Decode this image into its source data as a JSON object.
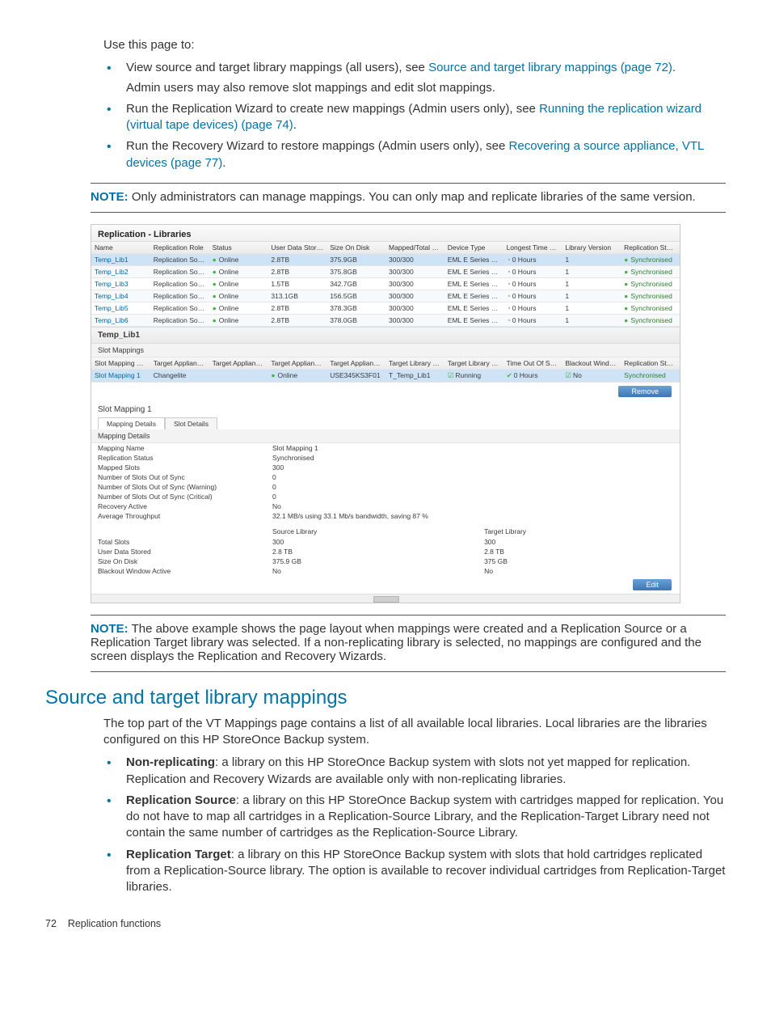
{
  "intro": "Use this page to:",
  "bullets_top": [
    {
      "pre": "View source and target library mappings (all users), see ",
      "link": "Source and target library mappings (page 72)",
      "post": ".",
      "sub": "Admin users may also remove slot mappings and edit slot mappings."
    },
    {
      "pre": "Run the Replication Wizard to create new mappings (Admin users only), see ",
      "link": "Running the replication wizard (virtual tape devices) (page 74)",
      "post": "."
    },
    {
      "pre": "Run the Recovery Wizard to restore mappings (Admin users only), see ",
      "link": "Recovering a source appliance, VTL devices (page 77)",
      "post": "."
    }
  ],
  "note1": {
    "label": "NOTE:",
    "text": "Only administrators can manage mappings. You can only map and replicate libraries of the same version."
  },
  "screenshot": {
    "title": "Replication - Libraries",
    "cols": [
      "Name",
      "Replication Role",
      "Status",
      "User Data Stored",
      "Size On Disk",
      "Mapped/Total S...",
      "Device Type",
      "Longest Time O...",
      "Library Version",
      "Replication Stat..."
    ],
    "rows": [
      {
        "name": "Temp_Lib1",
        "role": "Replication Sou...",
        "status": "Online",
        "uds": "2.8TB",
        "sod": "375.9GB",
        "mts": "300/300",
        "dt": "EML E Series / ...",
        "lto": "0 Hours",
        "lv": "1",
        "rs": "Synchronised",
        "sel": true
      },
      {
        "name": "Temp_Lib2",
        "role": "Replication Sou...",
        "status": "Online",
        "uds": "2.8TB",
        "sod": "375.8GB",
        "mts": "300/300",
        "dt": "EML E Series / ...",
        "lto": "0 Hours",
        "lv": "1",
        "rs": "Synchronised"
      },
      {
        "name": "Temp_Lib3",
        "role": "Replication Sou...",
        "status": "Online",
        "uds": "1.5TB",
        "sod": "342.7GB",
        "mts": "300/300",
        "dt": "EML E Series / ...",
        "lto": "0 Hours",
        "lv": "1",
        "rs": "Synchronised"
      },
      {
        "name": "Temp_Lib4",
        "role": "Replication Sou...",
        "status": "Online",
        "uds": "313.1GB",
        "sod": "156.5GB",
        "mts": "300/300",
        "dt": "EML E Series / ...",
        "lto": "0 Hours",
        "lv": "1",
        "rs": "Synchronised"
      },
      {
        "name": "Temp_Lib5",
        "role": "Replication Sou...",
        "status": "Online",
        "uds": "2.8TB",
        "sod": "378.3GB",
        "mts": "300/300",
        "dt": "EML E Series / ...",
        "lto": "0 Hours",
        "lv": "1",
        "rs": "Synchronised"
      },
      {
        "name": "Temp_Lib6",
        "role": "Replication Sou...",
        "status": "Online",
        "uds": "2.8TB",
        "sod": "378.0GB",
        "mts": "300/300",
        "dt": "EML E Series / ...",
        "lto": "0 Hours",
        "lv": "1",
        "rs": "Synchronised"
      }
    ],
    "detail_header": "Temp_Lib1",
    "detail_sub": "Slot Mappings",
    "map_cols": [
      "Slot Mapping Name",
      "Target Appliance Name",
      "Target Appliance Address",
      "Target Appliance Online",
      "Target Appliance Serial Number",
      "Target Library Name",
      "Target Library Status",
      "Time Out Of Sync",
      "Blackout Window Active",
      "Replication Status"
    ],
    "map_row": {
      "smn": "Slot Mapping 1",
      "tan": "Changelite",
      "taa": "",
      "tao": "Online",
      "tasn": "USE345KS3F01",
      "tln": "T_Temp_Lib1",
      "tls": "Running",
      "toos": "0 Hours",
      "bwa": "No",
      "rs": "Synchronised"
    },
    "remove_btn": "Remove",
    "sm_title": "Slot Mapping 1",
    "tabs": [
      "Mapping Details",
      "Slot Details"
    ],
    "tab_sub": "Mapping Details",
    "kv": [
      [
        "Mapping Name",
        "Slot Mapping 1"
      ],
      [
        "Replication Status",
        "Synchronised"
      ],
      [
        "Mapped Slots",
        "300"
      ],
      [
        "Number of Slots Out of Sync",
        "0"
      ],
      [
        "Number of Slots Out of Sync (Warning)",
        "0"
      ],
      [
        "Number of Slots Out of Sync (Critical)",
        "0"
      ],
      [
        "Recovery Active",
        "No"
      ],
      [
        "Average Throughput",
        "32.1 MB/s using 33.1 Mb/s bandwidth, saving 87 %"
      ]
    ],
    "split_heads": [
      "",
      "Source Library",
      "Target Library"
    ],
    "split_rows": [
      [
        "Total Slots",
        "300",
        "300"
      ],
      [
        "User Data Stored",
        "2.8 TB",
        "2.8 TB"
      ],
      [
        "Size On Disk",
        "375.9 GB",
        "375 GB"
      ],
      [
        "Blackout Window Active",
        "No",
        "No"
      ]
    ],
    "edit_btn": "Edit"
  },
  "note2": {
    "label": "NOTE:",
    "text": "The above example shows the page layout when mappings were created and a Replication Source or a Replication Target library was selected. If a non-replicating library is selected, no mappings are configured and the screen displays the Replication and Recovery Wizards."
  },
  "section_title": "Source and target library mappings",
  "section_intro": "The top part of the VT Mappings page contains a list of all available local libraries. Local libraries are the libraries configured on this HP StoreOnce Backup system.",
  "defs": [
    {
      "term": "Non-replicating",
      "text": ": a library on this HP StoreOnce Backup system with slots not yet mapped for replication. Replication and Recovery Wizards are available only with non-replicating libraries."
    },
    {
      "term": "Replication Source",
      "text": ": a library on this HP StoreOnce Backup system with cartridges mapped for replication. You do not have to map all cartridges in a Replication-Source Library, and the Replication-Target Library need not contain the same number of cartridges as the Replication-Source Library."
    },
    {
      "term": "Replication Target",
      "text": ": a library on this HP StoreOnce Backup system with slots that hold cartridges replicated from a Replication-Source library. The option is available to recover individual cartridges from Replication-Target libraries."
    }
  ],
  "footer": {
    "page": "72",
    "title": "Replication functions"
  }
}
